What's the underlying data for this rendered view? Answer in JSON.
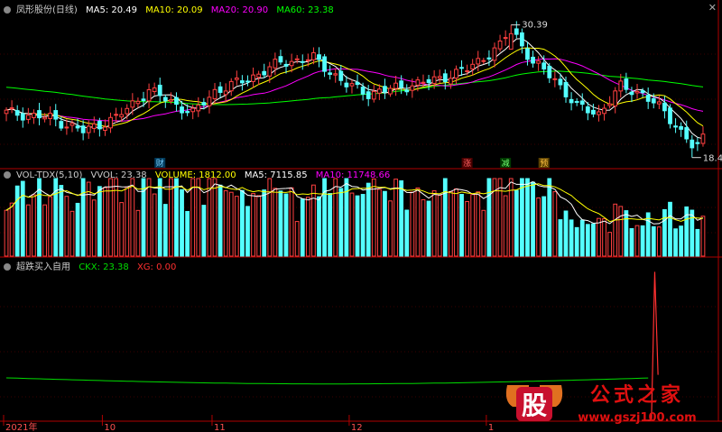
{
  "colors": {
    "up": "#ff4040",
    "down": "#54ffff",
    "ma5": "#ffffff",
    "ma10": "#ffff00",
    "ma20": "#ff00ff",
    "ma60": "#00ff00",
    "axis": "#b00000",
    "ckx": "#00dd00",
    "xg": "#ff3030"
  },
  "header": {
    "title": "凤形股份(日线)",
    "ma5": "MA5: 20.49",
    "ma10": "MA10: 20.09",
    "ma20": "MA20: 20.90",
    "ma60": "MA60: 23.38"
  },
  "vol_header": {
    "title": "VOL-TDX(5,10)",
    "vvol": "VVOL: 23.38",
    "volume": "VOLUME: 1812.00",
    "ma5": "MA5: 7115.85",
    "ma10": "MA10: 11748.66"
  },
  "ind_header": {
    "title": "超跌买入自用",
    "ckx": "CKX: 23.38",
    "xg": "XG: 0.00"
  },
  "markers": {
    "cai": "财",
    "zhang": "涨",
    "jian": "减",
    "yu": "预"
  },
  "watermark": {
    "logo": "股",
    "title": "公式之家",
    "url": "www.gszj100.com"
  },
  "chart_data": [
    {
      "type": "candlestick",
      "title": "凤形股份(日线)",
      "annotations": [
        {
          "label": "30.39",
          "kind": "high"
        },
        {
          "label": "18.42",
          "kind": "low"
        }
      ],
      "series": [
        {
          "name": "MA5",
          "last": 20.49
        },
        {
          "name": "MA10",
          "last": 20.09
        },
        {
          "name": "MA20",
          "last": 20.9
        },
        {
          "name": "MA60",
          "last": 23.38
        }
      ],
      "ylim": [
        17.5,
        31.5
      ]
    },
    {
      "type": "bar",
      "title": "VOL-TDX(5,10)",
      "series": [
        {
          "name": "VOLUME",
          "last": 1812.0
        },
        {
          "name": "MA5",
          "last": 7115.85
        },
        {
          "name": "MA10",
          "last": 11748.66
        }
      ]
    },
    {
      "type": "line",
      "title": "超跌买入自用",
      "series": [
        {
          "name": "CKX",
          "last": 23.38
        },
        {
          "name": "XG",
          "last": 0.0
        }
      ]
    }
  ],
  "xaxis": {
    "labels": [
      {
        "text": "2021年",
        "index": 0
      },
      {
        "text": "10",
        "index": 18
      },
      {
        "text": "11",
        "index": 38
      },
      {
        "text": "12",
        "index": 63
      },
      {
        "text": "1",
        "index": 88
      }
    ]
  }
}
